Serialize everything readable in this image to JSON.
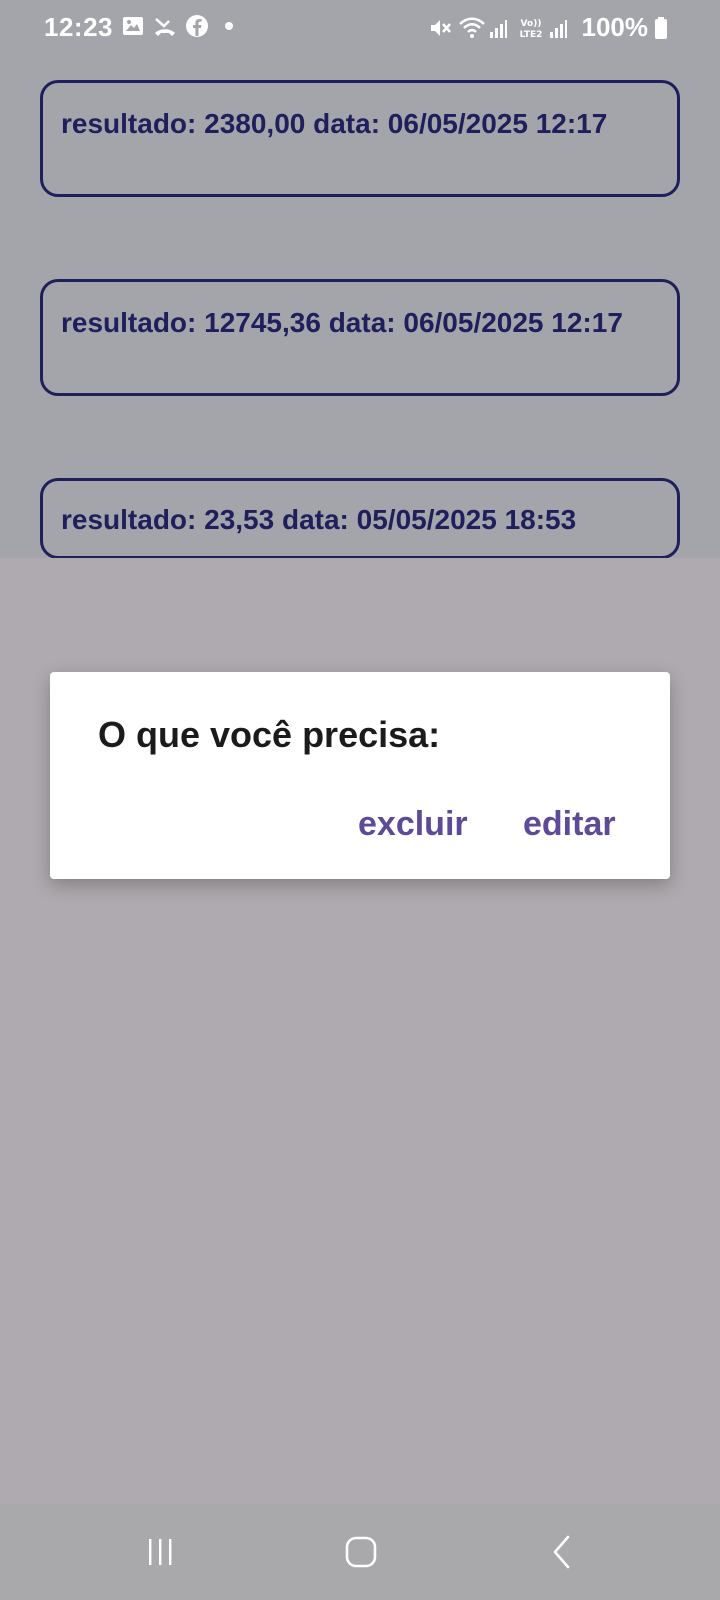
{
  "status_bar": {
    "time": "12:23",
    "battery": "100%",
    "left_icons": [
      "gallery-icon",
      "missed-call-icon",
      "facebook-icon",
      "dot-icon"
    ],
    "right_icons": [
      "mute-icon",
      "wifi-icon",
      "signal-icon",
      "volte-lte2-icon",
      "signal-icon",
      "battery-icon"
    ]
  },
  "history": {
    "items": [
      {
        "text": "resultado: 2380,00 data: 06/05/2025 12:17"
      },
      {
        "text": "resultado: 12745,36 data: 06/05/2025 12:17"
      },
      {
        "text": "resultado: 23,53 data: 05/05/2025 18:53"
      }
    ]
  },
  "dialog": {
    "title": "O que você precisa:",
    "delete_label": "excluir",
    "edit_label": "editar"
  },
  "nav_bar": {
    "icons": [
      "recents-icon",
      "home-icon",
      "back-icon"
    ]
  },
  "colors": {
    "card_border": "#1e1f5c",
    "card_text": "#1e1f5c",
    "dialog_button": "#5d4b99",
    "scrim_top": "#a4a5aa",
    "scrim_bottom": "#aeaaaf"
  }
}
